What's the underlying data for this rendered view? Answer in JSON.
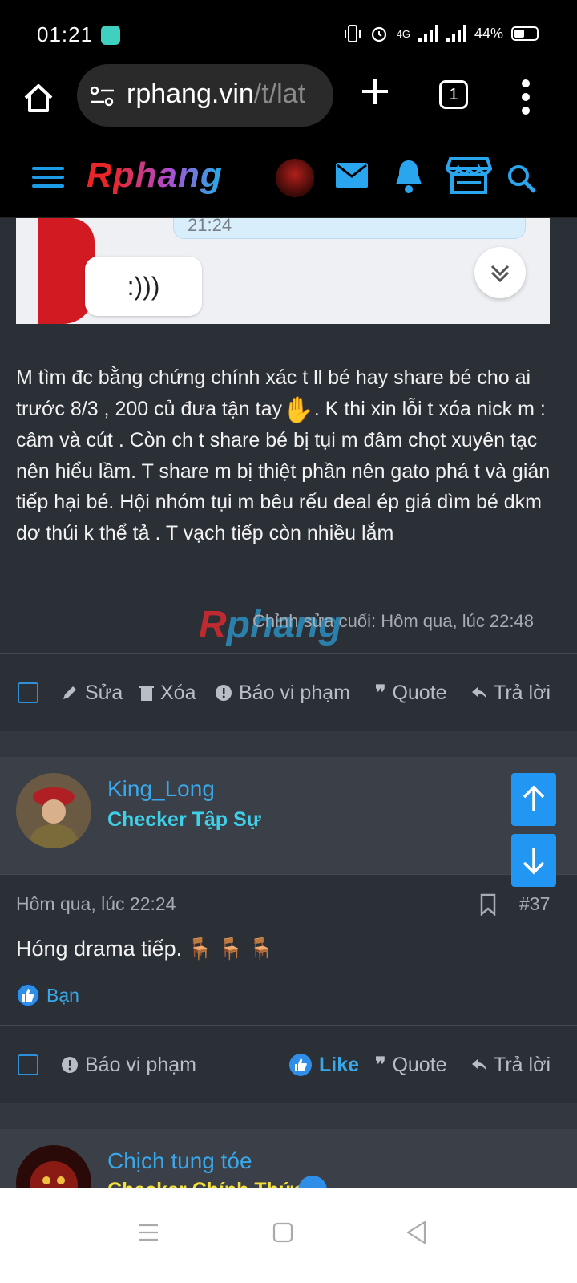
{
  "status_bar": {
    "time": "01:21",
    "network": "4G",
    "battery": "44%"
  },
  "browser": {
    "url_main": "rphang.vin",
    "url_path": "/t/lat",
    "tab_count": "1"
  },
  "site": {
    "logo_first": "R",
    "logo_rest": "phang"
  },
  "post1": {
    "chat_time": "21:24",
    "chat_message": ":)))",
    "text_part1": "M tìm đc bằng chứng chính xác t ll bé hay share bé cho ai trước 8/3 , 200 củ đưa tận tay",
    "emoji": "✋",
    "text_part2": ". K thi xin lỗi t xóa nick m : câm và cút . Còn ch t share bé bị tụi m đâm chọt xuyên tạc nên hiểu lầm. T share m bị thiệt phần nên gato phá t và gián tiếp hại bé. Hội nhóm tụi m bêu rếu deal ép giá dìm bé dkm dơ thúi k thể tả . T vạch tiếp còn nhiều lắm",
    "edit_note": "Chỉnh sửa cuối: Hôm qua, lúc 22:48",
    "actions": {
      "edit": "Sửa",
      "delete": "Xóa",
      "report": "Báo vi phạm",
      "quote": "Quote",
      "reply": "Trả lời"
    }
  },
  "post2": {
    "username": "King_Long",
    "user_title": "Checker Tập Sự",
    "date": "Hôm qua, lúc 22:24",
    "number": "#37",
    "text": "Hóng drama tiếp.",
    "reaction_label": "Bạn",
    "actions": {
      "report": "Báo vi phạm",
      "like": "Like",
      "quote": "Quote",
      "reply": "Trả lời"
    }
  },
  "post3": {
    "username": "Chịch tung tóe",
    "user_title": "Checker Chính Thức"
  },
  "colors": {
    "accent": "#2196f3",
    "link": "#3aa8e8",
    "title_cyan": "#3fd0e8",
    "title_yellow": "#f5e03a",
    "background": "#2b2f36"
  }
}
